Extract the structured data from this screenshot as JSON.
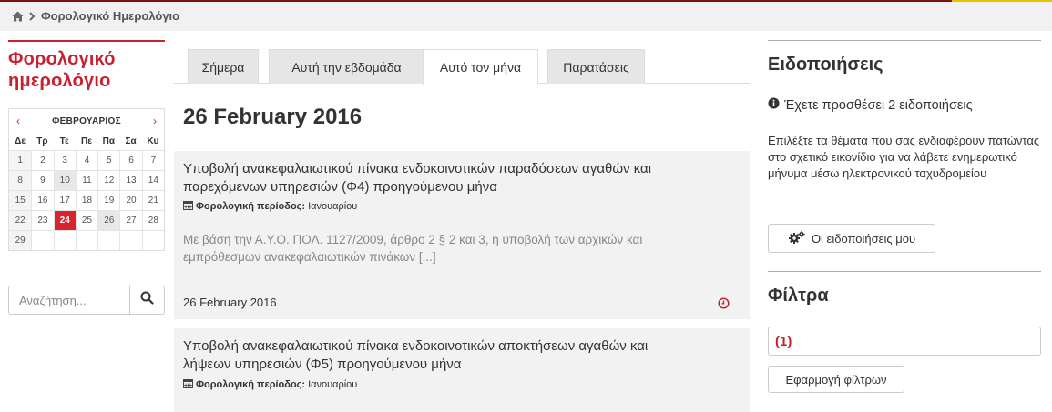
{
  "breadcrumb": {
    "home_icon": "home-icon",
    "separator_icon": "chevron-right-icon",
    "current": "Φορολογικό Ημερολόγιο"
  },
  "sidebar": {
    "title_line1": "Φορολογικό",
    "title_line2": "ημερολόγιο",
    "calendar": {
      "month": "ΦΕΒΡΟΥΑΡΙΟΣ",
      "prev": "‹",
      "next": "›",
      "weekdays": [
        "Δε",
        "Τρ",
        "Τε",
        "Πε",
        "Πα",
        "Σα",
        "Κυ"
      ],
      "weeks": [
        [
          "1",
          "2",
          "3",
          "4",
          "5",
          "6",
          "7"
        ],
        [
          "8",
          "9",
          "10",
          "11",
          "12",
          "13",
          "14"
        ],
        [
          "15",
          "16",
          "17",
          "18",
          "19",
          "20",
          "21"
        ],
        [
          "22",
          "23",
          "24",
          "25",
          "26",
          "27",
          "28"
        ],
        [
          "29",
          "",
          "",
          "",
          "",
          "",
          ""
        ]
      ],
      "today": "24"
    },
    "search": {
      "placeholder": "Αναζήτηση...",
      "icon": "search-icon"
    }
  },
  "tabs": [
    {
      "label": "Σήμερα"
    },
    {
      "label": "Αυτή την εβδομάδα"
    },
    {
      "label": "Αυτό τον μήνα",
      "active": true
    },
    {
      "label": "Παρατάσεις"
    }
  ],
  "main": {
    "date_title": "26 February 2016",
    "items": [
      {
        "title_line1": "Υποβολή ανακεφαλαιωτικού πίνακα ενδοκοινοτικών παραδόσεων αγαθών και",
        "title_line2": "παρεχόμενων υπηρεσιών (Φ4) προηγούμενου μήνα",
        "period_label": "Φορολογική περίοδος:",
        "period_value": "Ιανουαρίου",
        "excerpt_line1": "Με βάση την Α.Υ.Ο. ΠΟΛ. 1127/2009, άρθρο 2 § 2 και 3, η υποβολή των αρχικών και",
        "excerpt_line2": "εμπρόθεσμων ανακεφαλαιωτικών πινάκων [...]",
        "date": "26 February 2016"
      },
      {
        "title_line1": "Υποβολή ανακεφαλαιωτικού πίνακα ενδοκοινοτικών αποκτήσεων αγαθών και",
        "title_line2": "λήψεων υπηρεσιών (Φ5) προηγούμενου μήνα",
        "period_label": "Φορολογική περίοδος:",
        "period_value": "Ιανουαρίου"
      }
    ]
  },
  "notifications": {
    "heading": "Ειδοποιήσεις",
    "info": "Έχετε προσθέσει 2 ειδοποιήσεις",
    "description": "Επιλέξτε τα θέματα που σας ενδιαφέρουν πατώντας στο σχετικό εικονίδιο  για να λάβετε ενημερωτικό μήνυμα μέσω ηλεκτρονικού ταχυδρομείου",
    "button": "Οι ειδοποιήσεις μου"
  },
  "filters": {
    "heading": "Φίλτρα",
    "value": "(1)",
    "apply_button": "Εφαρμογή φίλτρων"
  },
  "colors": {
    "brand_red": "#c8202f",
    "today_red": "#d9232e",
    "topbar_border": "#7b1212"
  }
}
